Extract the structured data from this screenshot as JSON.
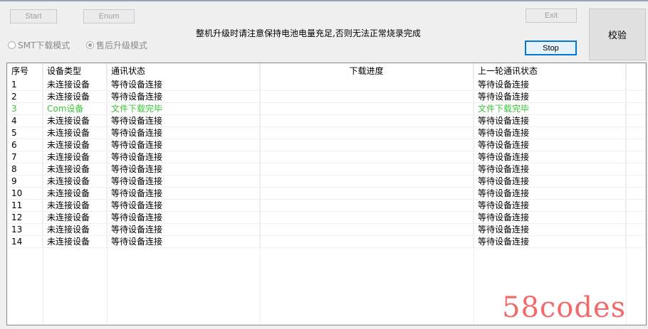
{
  "toolbar": {
    "start_label": "Start",
    "enum_label": "Enum",
    "exit_label": "Exit",
    "stop_label": "Stop",
    "verify_label": "校验"
  },
  "notice": "整机升级时请注意保持电池电量充足,否则无法正常烧录完成",
  "modes": {
    "smt_label": "SMT下载模式",
    "aftersale_label": "售后升级模式",
    "selected": "aftersale"
  },
  "table": {
    "columns": [
      "序号",
      "设备类型",
      "通讯状态",
      "下载进度",
      "上一轮通讯状态"
    ],
    "rows": [
      [
        "1",
        "未连接设备",
        "等待设备连接",
        "",
        "等待设备连接"
      ],
      [
        "2",
        "未连接设备",
        "等待设备连接",
        "",
        "等待设备连接"
      ],
      [
        "3",
        "Com设备",
        "文件下载完毕",
        "",
        "文件下载完毕"
      ],
      [
        "4",
        "未连接设备",
        "等待设备连接",
        "",
        "等待设备连接"
      ],
      [
        "5",
        "未连接设备",
        "等待设备连接",
        "",
        "等待设备连接"
      ],
      [
        "6",
        "未连接设备",
        "等待设备连接",
        "",
        "等待设备连接"
      ],
      [
        "7",
        "未连接设备",
        "等待设备连接",
        "",
        "等待设备连接"
      ],
      [
        "8",
        "未连接设备",
        "等待设备连接",
        "",
        "等待设备连接"
      ],
      [
        "9",
        "未连接设备",
        "等待设备连接",
        "",
        "等待设备连接"
      ],
      [
        "10",
        "未连接设备",
        "等待设备连接",
        "",
        "等待设备连接"
      ],
      [
        "11",
        "未连接设备",
        "等待设备连接",
        "",
        "等待设备连接"
      ],
      [
        "12",
        "未连接设备",
        "等待设备连接",
        "",
        "等待设备连接"
      ],
      [
        "13",
        "未连接设备",
        "等待设备连接",
        "",
        "等待设备连接"
      ],
      [
        "14",
        "未连接设备",
        "等待设备连接",
        "",
        "等待设备连接"
      ]
    ],
    "highlight_row": 2,
    "highlight_color": "#3cc43c"
  },
  "watermark": "58codes"
}
